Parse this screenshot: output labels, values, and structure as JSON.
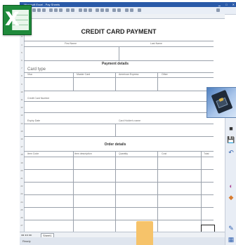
{
  "window": {
    "title": "Microsoft Excel - Pay Sheets"
  },
  "form": {
    "title": "CREDIT CARD PAYMENT",
    "first_name_label": "First Name",
    "last_name_label": "Last Name",
    "payment_details_heading": "Payment details",
    "card_type_label": "Card type",
    "visa_label": "Visa",
    "master_card_label": "Master Card",
    "american_express_label": "American Express",
    "other_label": "Other",
    "card_number_label": "Credit Card Number",
    "expiry_date_label": "Expiry Date",
    "cardholder_label": "Card Holder's name",
    "order_details_heading": "Order details",
    "item_code_label": "Item Code",
    "item_description_label": "Item description",
    "quantity_label": "Quantity",
    "cost_label": "Cost",
    "total_label": "Total"
  },
  "rows": [
    "1",
    "2",
    "3",
    "4",
    "5",
    "6",
    "7",
    "8",
    "9",
    "10",
    "11",
    "12",
    "13",
    "14",
    "15",
    "16",
    "17",
    "18",
    "19",
    "20",
    "21",
    "22",
    "23",
    "24",
    "25",
    "26",
    "27"
  ],
  "sheet_tab": "Sheet1",
  "status": "Ready",
  "colors": {
    "title_bar": "#2a5aa8",
    "excel_green": "#1f8a3b",
    "cursor": "#f6c36a"
  },
  "icons": [
    "excel-logo-icon",
    "card-reader-icon",
    "save-icon",
    "undo-icon",
    "color-palette-icon",
    "pencil-icon"
  ]
}
